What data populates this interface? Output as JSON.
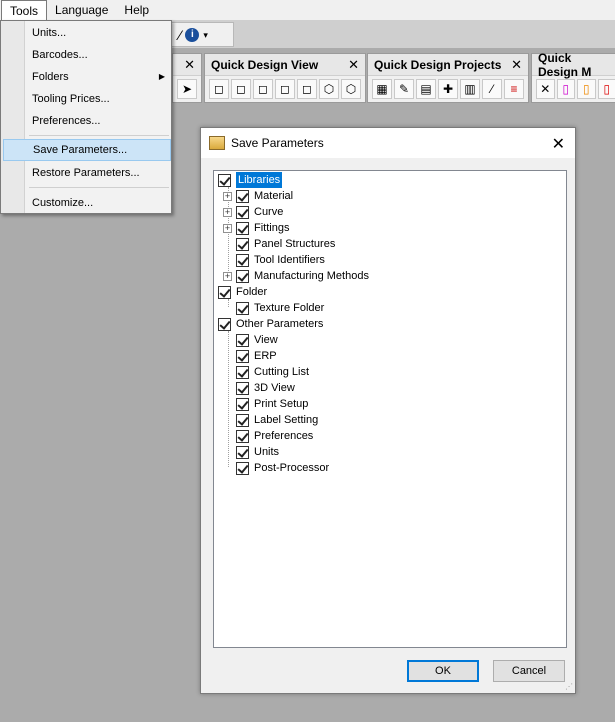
{
  "menubar": {
    "items": [
      {
        "label": "Tools",
        "open": true
      },
      {
        "label": "Language"
      },
      {
        "label": "Help"
      }
    ]
  },
  "toolbar": {
    "wand_icon": "magic-wand-icon",
    "info_glyph": "i"
  },
  "panels": [
    {
      "title": "",
      "close": "✕",
      "icons": [
        "arrow-select-icon"
      ]
    },
    {
      "title": "Quick Design View",
      "close": "✕",
      "icons": [
        "cube-front-icon",
        "cube-left-icon",
        "cube-right-icon",
        "cube-back-icon",
        "cube-top-icon",
        "cube-iso1-icon",
        "cube-iso2-icon"
      ]
    },
    {
      "title": "Quick Design Projects",
      "close": "✕",
      "icons": [
        "checker-icon",
        "pencil-icon",
        "table-icon",
        "plus-icon",
        "columns-icon",
        "wand-icon",
        "lines-icon"
      ]
    },
    {
      "title": "Quick Design M",
      "close": "",
      "icons": [
        "tools-icon",
        "rect-magenta-icon",
        "rect-multicolor-icon",
        "rect-red-icon"
      ]
    }
  ],
  "tools_menu": {
    "items": [
      {
        "label": "Units..."
      },
      {
        "label": "Barcodes..."
      },
      {
        "label": "Folders",
        "submenu": true
      },
      {
        "label": "Tooling Prices..."
      },
      {
        "label": "Preferences..."
      },
      {
        "label": "Save Parameters...",
        "selected": true
      },
      {
        "label": "Restore Parameters..."
      },
      {
        "label": "Customize..."
      }
    ],
    "submenu_arrow": "▶"
  },
  "dialog": {
    "title": "Save Parameters",
    "close": "✕",
    "tree": [
      {
        "label": "Libraries",
        "level": 0,
        "checked": true,
        "highlight": true
      },
      {
        "label": "Material",
        "level": 1,
        "checked": true,
        "expandable": true
      },
      {
        "label": "Curve",
        "level": 1,
        "checked": true,
        "expandable": true
      },
      {
        "label": "Fittings",
        "level": 1,
        "checked": true,
        "expandable": true
      },
      {
        "label": "Panel Structures",
        "level": 1,
        "checked": true
      },
      {
        "label": "Tool Identifiers",
        "level": 1,
        "checked": true
      },
      {
        "label": "Manufacturing Methods",
        "level": 1,
        "checked": true,
        "expandable": true
      },
      {
        "label": "Folder",
        "level": 0,
        "checked": true
      },
      {
        "label": "Texture Folder",
        "level": 1,
        "checked": true
      },
      {
        "label": "Other Parameters",
        "level": 0,
        "checked": true
      },
      {
        "label": "View",
        "level": 1,
        "checked": true
      },
      {
        "label": "ERP",
        "level": 1,
        "checked": true
      },
      {
        "label": "Cutting List",
        "level": 1,
        "checked": true
      },
      {
        "label": "3D View",
        "level": 1,
        "checked": true
      },
      {
        "label": "Print Setup",
        "level": 1,
        "checked": true
      },
      {
        "label": "Label Setting",
        "level": 1,
        "checked": true
      },
      {
        "label": "Preferences",
        "level": 1,
        "checked": true
      },
      {
        "label": "Units",
        "level": 1,
        "checked": true
      },
      {
        "label": "Post-Processor",
        "level": 1,
        "checked": true
      }
    ],
    "ok_label": "OK",
    "cancel_label": "Cancel"
  },
  "colors": {
    "selection": "#0078d7",
    "menu_selected": "#cce4f7",
    "desktop": "#ababab"
  }
}
